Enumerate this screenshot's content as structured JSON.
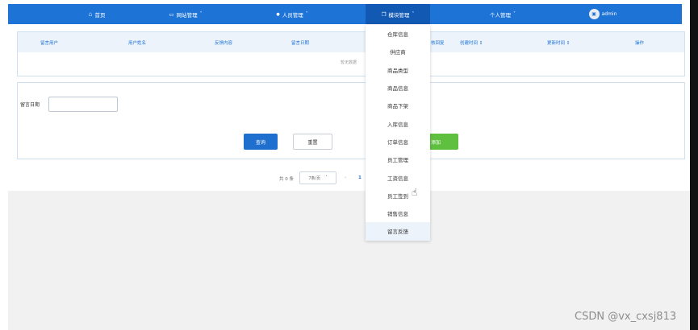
{
  "nav": {
    "items": [
      {
        "label": "首页",
        "icon": "home-icon",
        "glyph": "⌂",
        "chevron": ""
      },
      {
        "label": "网站管理",
        "icon": "monitor-icon",
        "glyph": "▭",
        "chevron": "˅"
      },
      {
        "label": "人员管理",
        "icon": "user-icon",
        "glyph": "●",
        "chevron": "˅"
      },
      {
        "label": "模块管理",
        "icon": "copy-icon",
        "glyph": "❐",
        "chevron": "˄"
      },
      {
        "label": "个人管理",
        "icon": "",
        "glyph": "",
        "chevron": "˅"
      }
    ],
    "user": {
      "avatar_glyph": "▣",
      "name": "admin"
    },
    "colors": {
      "bar": "#1e74d6",
      "active": "#1259b3"
    }
  },
  "table": {
    "headers": [
      "留言用户",
      "用户姓名",
      "反馈内容",
      "留言日期",
      "核回复",
      "创建时间 ↕",
      "更新时间 ↕",
      "操作"
    ],
    "empty_text": "暂无数据"
  },
  "search": {
    "date_label": "留言日期",
    "date_value": "",
    "query_label": "查询",
    "reset_label": "重置",
    "add_label": "添加"
  },
  "pagination": {
    "total_text": "共 0 条",
    "page_size": "7条/页",
    "page_size_chevron": "˅",
    "prev": "‹",
    "current_page": "1"
  },
  "dropdown": {
    "items": [
      "仓库信息",
      "供应商",
      "商品类型",
      "商品信息",
      "商品下架",
      "入库信息",
      "订单信息",
      "员工管理",
      "工资信息",
      "员工签到",
      "销售信息",
      "留言反馈"
    ],
    "selected_index": 11
  },
  "cursor_glyph": "☝",
  "watermark": "CSDN @vx_cxsj813"
}
